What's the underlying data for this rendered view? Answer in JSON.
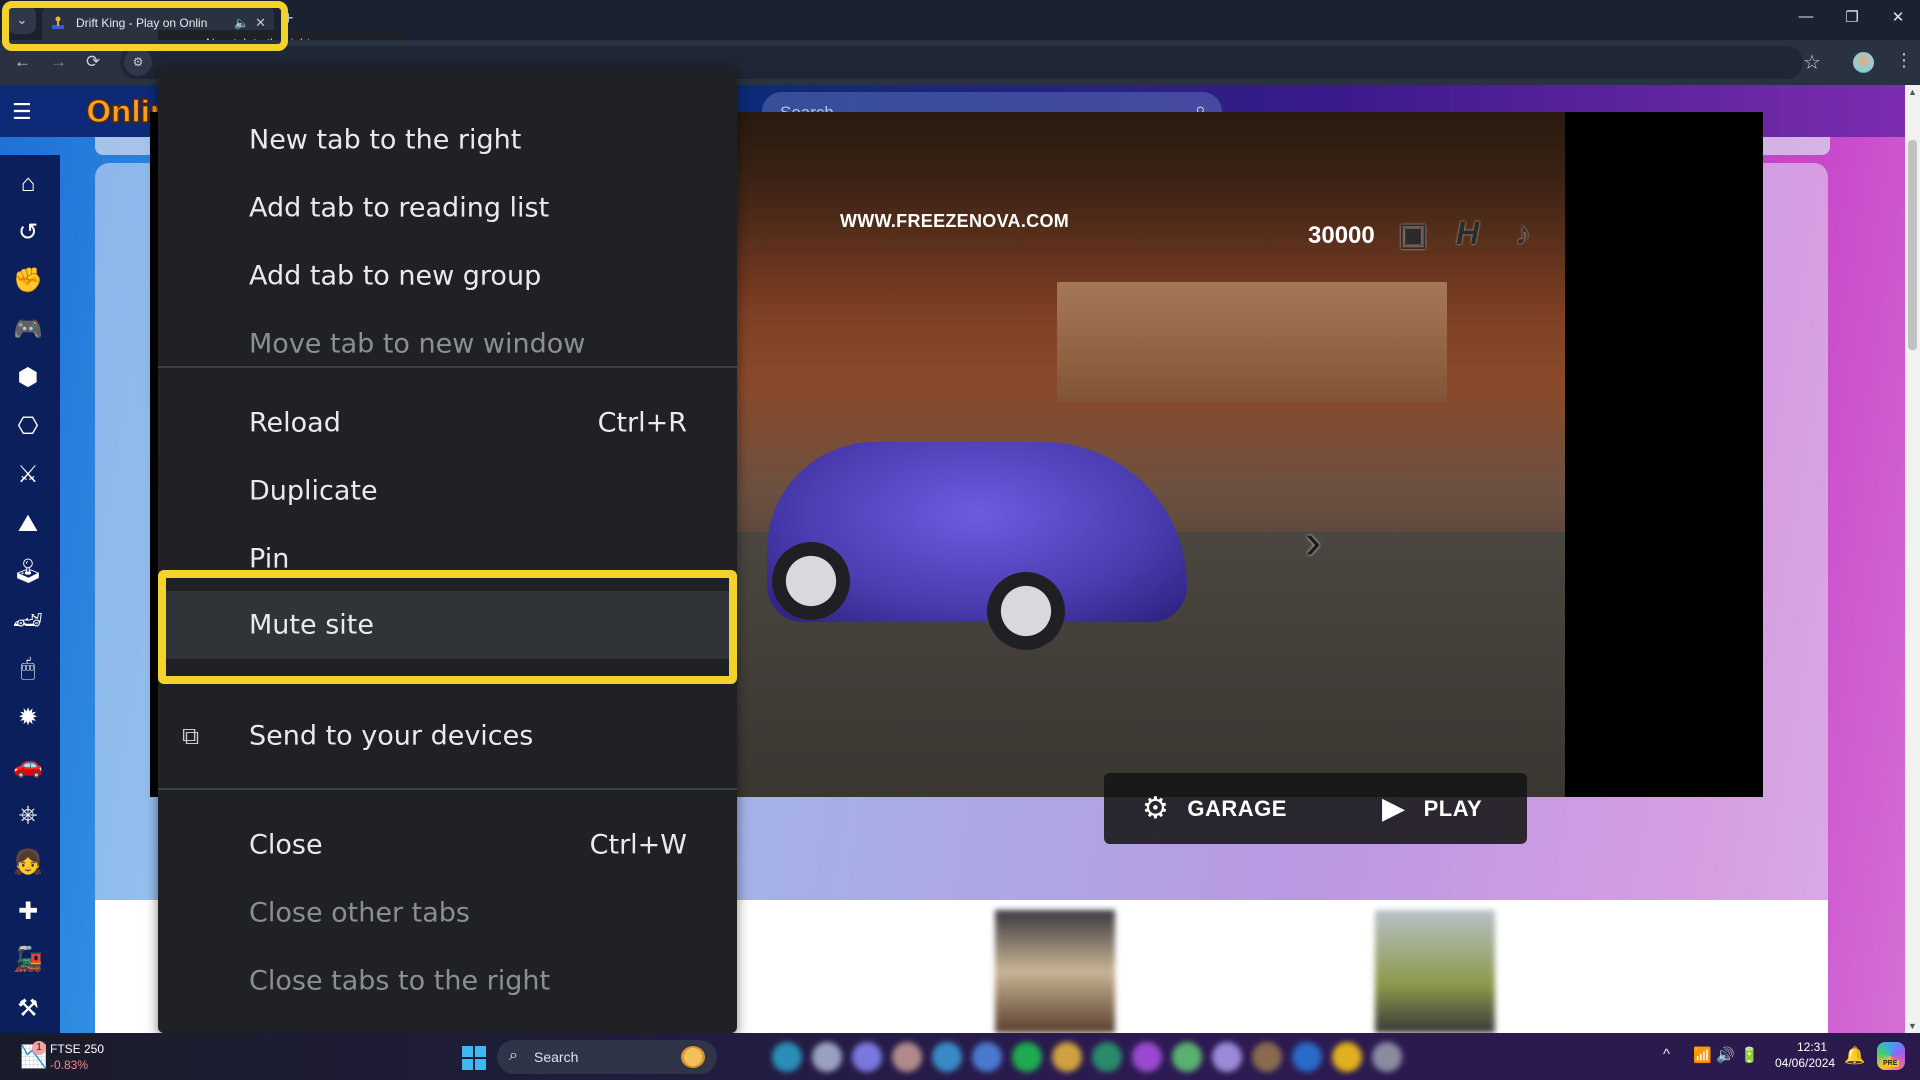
{
  "browser": {
    "tab": {
      "title": "Drift King - Play on Online Games",
      "title_visible": "Drift King - Play on Onlin",
      "favicon": "joystick-icon",
      "audio_icon": "speaker-icon",
      "close_icon": "close-icon"
    },
    "tab_search_icon": "chevron-down-icon",
    "new_tab_icon": "plus-icon",
    "tooltip": "New tab to the right",
    "window_controls": {
      "minimize": "—",
      "restore": "❐",
      "close": "✕"
    },
    "nav": {
      "back": "←",
      "forward": "→",
      "reload": "⟳",
      "site_info": "⚙"
    },
    "bookmark_icon": "☆",
    "menu_icon": "⋮"
  },
  "page": {
    "logo_text": "Online",
    "search_placeholder": "Search",
    "search_icon": "⌕",
    "hamburger_icon": "☰",
    "sidebar_icons": [
      {
        "name": "home-icon",
        "glyph": "⌂"
      },
      {
        "name": "history-icon",
        "glyph": "↺"
      },
      {
        "name": "fist-controller-icon",
        "glyph": "✊"
      },
      {
        "name": "two-controllers-icon",
        "glyph": "🎮"
      },
      {
        "name": "dice-icon",
        "glyph": "⬢"
      },
      {
        "name": "cube-controller-icon",
        "glyph": "⎔"
      },
      {
        "name": "crossed-swords-icon",
        "glyph": "⚔"
      },
      {
        "name": "hiker-icon",
        "glyph": "⛰"
      },
      {
        "name": "joystick-icon",
        "glyph": "🕹"
      },
      {
        "name": "race-car-icon",
        "glyph": "🏎"
      },
      {
        "name": "mouse-click-icon",
        "glyph": "🖱"
      },
      {
        "name": "gear-burst-icon",
        "glyph": "✹"
      },
      {
        "name": "drift-car-icon",
        "glyph": "🚗"
      },
      {
        "name": "steering-wheel-icon",
        "glyph": "⎈"
      },
      {
        "name": "girl-gamer-icon",
        "glyph": "👧"
      },
      {
        "name": "gamepad-icon",
        "glyph": "✚"
      },
      {
        "name": "train-icon",
        "glyph": "🚂"
      },
      {
        "name": "minecraft-character-icon",
        "glyph": "⚒"
      }
    ],
    "game": {
      "url_label": "WWW.FREEZENOVA.COM",
      "coins": "30000",
      "wallet_icon": "▣",
      "h_icon": "H",
      "music_icon": "♪",
      "next_icon": "›",
      "garage_label": "GARAGE",
      "garage_icon": "⚙",
      "play_label": "PLAY",
      "play_icon": "▶"
    }
  },
  "context_menu": {
    "items": [
      {
        "label": "New tab to the right",
        "shortcut": "",
        "disabled": false
      },
      {
        "label": "Add tab to reading list",
        "shortcut": "",
        "disabled": false
      },
      {
        "label": "Add tab to new group",
        "shortcut": "",
        "disabled": false
      },
      {
        "label": "Move tab to new window",
        "shortcut": "",
        "disabled": true
      },
      {
        "label": "Reload",
        "shortcut": "Ctrl+R",
        "disabled": false
      },
      {
        "label": "Duplicate",
        "shortcut": "",
        "disabled": false
      },
      {
        "label": "Pin",
        "shortcut": "",
        "disabled": false
      },
      {
        "label": "Mute site",
        "shortcut": "",
        "disabled": false,
        "highlighted": true
      },
      {
        "label": "Send to your devices",
        "shortcut": "",
        "disabled": false,
        "icon": "devices-icon"
      },
      {
        "label": "Close",
        "shortcut": "Ctrl+W",
        "disabled": false
      },
      {
        "label": "Close other tabs",
        "shortcut": "",
        "disabled": true
      },
      {
        "label": "Close tabs to the right",
        "shortcut": "",
        "disabled": true
      }
    ],
    "devices_icon": "⧉"
  },
  "taskbar": {
    "weather": {
      "badge": "1",
      "title": "FTSE 250",
      "change": "-0.83%"
    },
    "search_placeholder": "Search",
    "search_icon": "⌕",
    "tray": {
      "chevron": "^",
      "wifi": "📶",
      "volume": "🔊",
      "battery": "🔋"
    },
    "time": "12:31",
    "date": "04/06/2024",
    "bell": "🔔",
    "copilot_badge": "PRE"
  },
  "colors": {
    "highlight": "#f4d22c",
    "menu_bg": "#1f2125",
    "menu_hover": "#303337"
  }
}
